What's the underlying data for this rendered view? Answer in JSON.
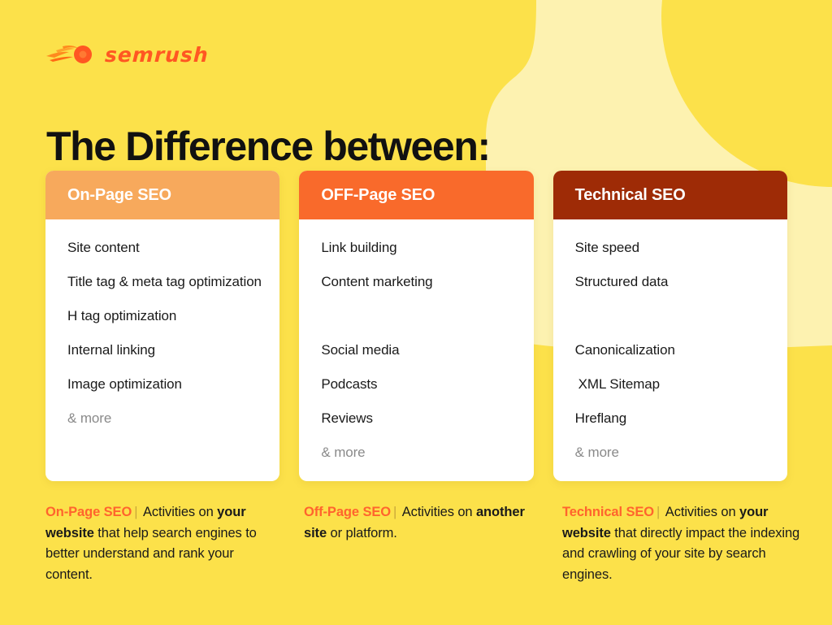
{
  "brand": {
    "logo_text": "semrush",
    "logo_icon": "semrush-comet-flame-icon",
    "logo_color": "#FF5722"
  },
  "page": {
    "title": "The Difference between:",
    "background_color": "#FCE14A",
    "background_accent_color": "#FDF2B0"
  },
  "cards": [
    {
      "id": "on-page-seo",
      "title": "On-Page SEO",
      "header_color": "#F7A95C",
      "items": [
        {
          "text": "Site content",
          "muted": false,
          "spacer": false,
          "indent": false
        },
        {
          "text": "Title tag & meta tag optimization",
          "muted": false,
          "spacer": false,
          "indent": false
        },
        {
          "text": "H tag optimization",
          "muted": false,
          "spacer": false,
          "indent": false
        },
        {
          "text": "Internal linking",
          "muted": false,
          "spacer": false,
          "indent": false
        },
        {
          "text": "Image optimization",
          "muted": false,
          "spacer": false,
          "indent": false
        },
        {
          "text": "& more",
          "muted": true,
          "spacer": false,
          "indent": false
        }
      ]
    },
    {
      "id": "off-page-seo",
      "title": "OFF-Page SEO",
      "header_color": "#F96A2B",
      "items": [
        {
          "text": "Link building",
          "muted": false,
          "spacer": false,
          "indent": false
        },
        {
          "text": "Content marketing",
          "muted": false,
          "spacer": false,
          "indent": false
        },
        {
          "text": "",
          "muted": false,
          "spacer": true,
          "indent": false
        },
        {
          "text": "Social media",
          "muted": false,
          "spacer": false,
          "indent": false
        },
        {
          "text": "Podcasts",
          "muted": false,
          "spacer": false,
          "indent": false
        },
        {
          "text": "Reviews",
          "muted": false,
          "spacer": false,
          "indent": false
        },
        {
          "text": "& more",
          "muted": true,
          "spacer": false,
          "indent": false
        }
      ]
    },
    {
      "id": "technical-seo",
      "title": "Technical SEO",
      "header_color": "#9E2B06",
      "items": [
        {
          "text": "Site speed",
          "muted": false,
          "spacer": false,
          "indent": false
        },
        {
          "text": "Structured data",
          "muted": false,
          "spacer": false,
          "indent": false
        },
        {
          "text": "",
          "muted": false,
          "spacer": true,
          "indent": false
        },
        {
          "text": "Canonicalization",
          "muted": false,
          "spacer": false,
          "indent": false
        },
        {
          "text": "XML Sitemap",
          "muted": false,
          "spacer": false,
          "indent": true
        },
        {
          "text": "Hreflang",
          "muted": false,
          "spacer": false,
          "indent": false
        },
        {
          "text": "& more",
          "muted": true,
          "spacer": false,
          "indent": false
        }
      ]
    }
  ],
  "captions": [
    {
      "id": "on-page-seo-caption",
      "lead": "On-Page SEO",
      "separator": "|",
      "parts": [
        {
          "text": " Activities on ",
          "bold": false
        },
        {
          "text": "your website",
          "bold": true
        },
        {
          "text": " that help search engines to better understand and rank your content.",
          "bold": false
        }
      ]
    },
    {
      "id": "off-page-seo-caption",
      "lead": "Off-Page SEO",
      "separator": "|",
      "parts": [
        {
          "text": " Activities on ",
          "bold": false
        },
        {
          "text": "another site",
          "bold": true
        },
        {
          "text": " or platform.",
          "bold": false
        }
      ]
    },
    {
      "id": "technical-seo-caption",
      "lead": "Technical SEO",
      "separator": "|",
      "parts": [
        {
          "text": " Activities on ",
          "bold": false
        },
        {
          "text": "your website",
          "bold": true
        },
        {
          "text": " that directly impact the indexing and crawling of your site by search engines.",
          "bold": false
        }
      ]
    }
  ]
}
